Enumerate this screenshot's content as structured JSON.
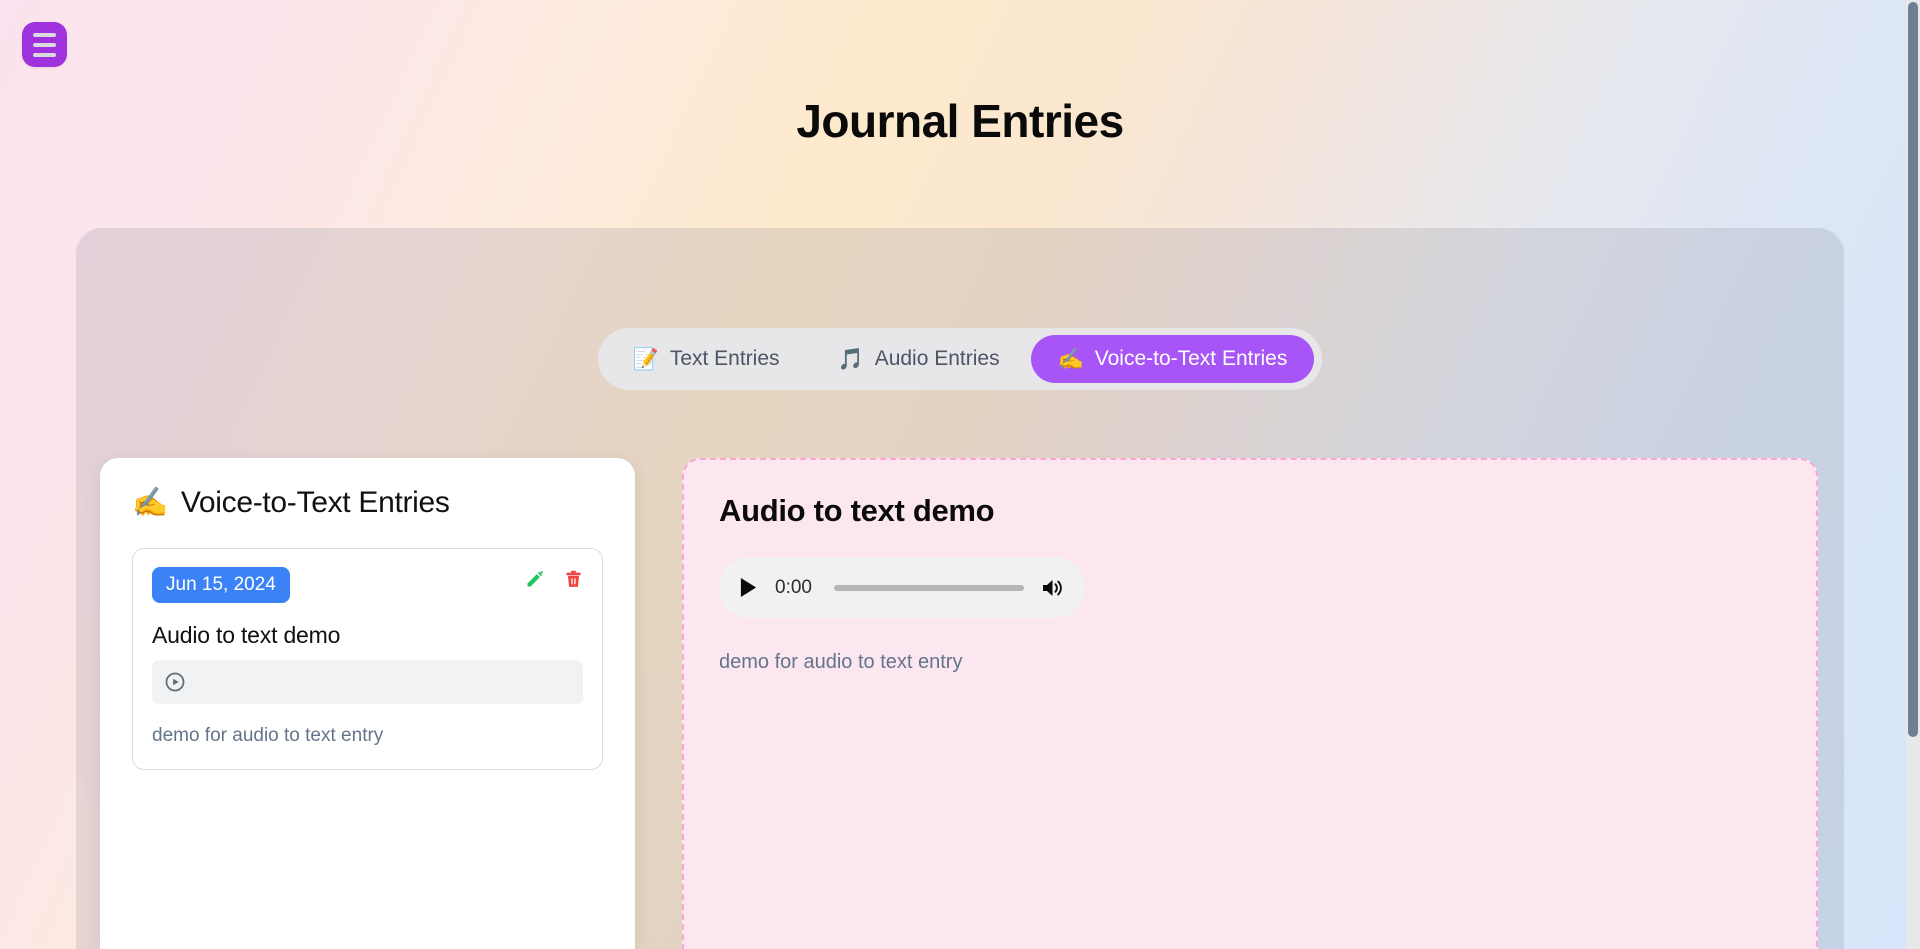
{
  "window": {
    "title": "Journal Entries"
  },
  "menu_button": {
    "name": "hamburger-menu",
    "color": "#a032dd"
  },
  "tabs": [
    {
      "id": "text",
      "emoji": "📝",
      "label": "Text Entries",
      "active": false
    },
    {
      "id": "audio",
      "emoji": "🎵",
      "label": "Audio Entries",
      "active": false
    },
    {
      "id": "voice",
      "emoji": "✍️",
      "label": "Voice-to-Text Entries",
      "active": true
    }
  ],
  "entries_panel": {
    "emoji": "✍️",
    "title": "Voice-to-Text Entries",
    "items": [
      {
        "date": "Jun 15, 2024",
        "title": "Audio to text demo",
        "description": "demo for audio to text entry",
        "edit_icon": "✏️",
        "delete_icon": "🗑️",
        "date_badge_color": "#3b82f6"
      }
    ]
  },
  "detail_panel": {
    "title": "Audio to text demo",
    "description": "demo for audio to text entry",
    "player": {
      "current_time": "0:00",
      "progress_percent": 0
    },
    "background_color": "#fce7f0",
    "border_color": "#f9a8d4"
  },
  "theme": {
    "accent_purple": "#a855f7",
    "badge_blue": "#3b82f6",
    "edit_green": "#22c55e",
    "delete_red": "#ef4444"
  }
}
